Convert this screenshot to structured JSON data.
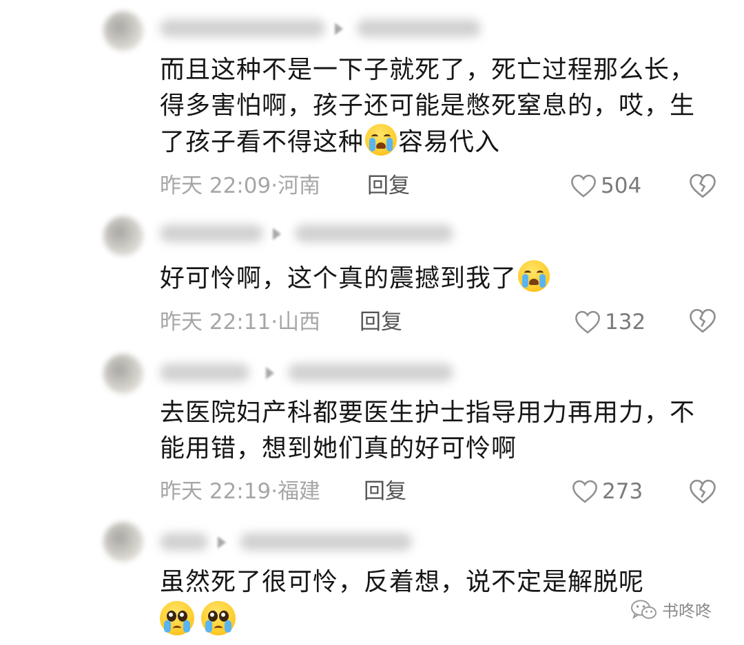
{
  "comments": [
    {
      "text_before": "而且这种不是一下子就死了，死亡过程那么长，得多害怕啊，孩子还可能是憋死窒息的，哎，生了孩子看不得这种",
      "emoji": "loudly-crying-face-icon",
      "text_after": "容易代入",
      "time": "昨天 22:09",
      "location": "河南",
      "reply_label": "回复",
      "likes": "504"
    },
    {
      "text_before": "好可怜啊，这个真的震撼到我了",
      "emoji": "loudly-crying-face-icon",
      "text_after": "",
      "time": "昨天 22:11",
      "location": "山西",
      "reply_label": "回复",
      "likes": "132"
    },
    {
      "text_before": "去医院妇产科都要医生护士指导用力再用力，不能用错，想到她们真的好可怜啊",
      "emoji": "",
      "text_after": "",
      "time": "昨天 22:19",
      "location": "福建",
      "reply_label": "回复",
      "likes": "273"
    },
    {
      "text_before": "虽然死了很可怜，反着想，说不定是解脱呢",
      "emoji": "pleading-face-icon",
      "text_after": "",
      "time": "",
      "location": "",
      "reply_label": "",
      "likes": ""
    }
  ],
  "watermark": {
    "text": "书咚咚",
    "icon": "wechat-icon"
  },
  "colors": {
    "meta": "#a6a6a6",
    "body_text": "#161616",
    "emoji_yellow": "#ffcc2a",
    "tear_blue": "#5ab4f2"
  }
}
